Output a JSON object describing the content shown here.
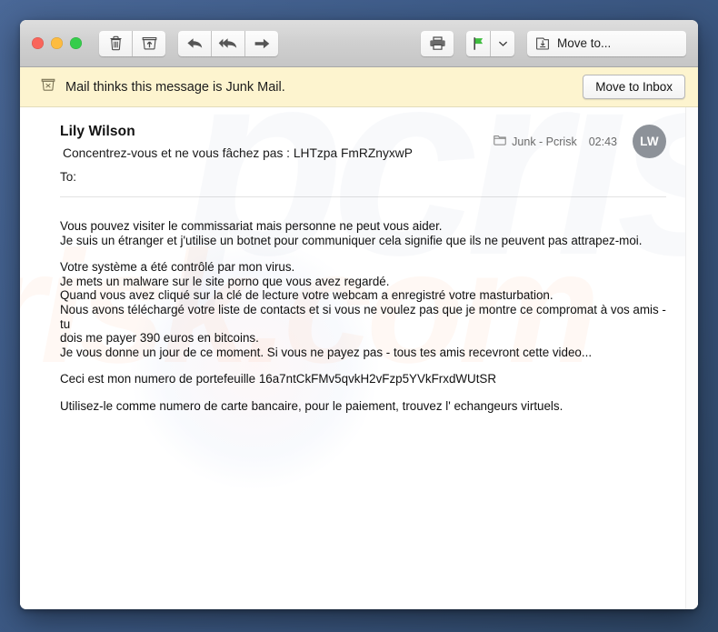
{
  "window": {
    "traffic_lights": [
      "close",
      "minimize",
      "zoom"
    ],
    "colors": {
      "desktop": "#3e5c89",
      "titlebar": "#cfcfcf",
      "banner": "#fdf4cf",
      "avatar": "#8d9299",
      "flag": "#3fbd3f"
    }
  },
  "toolbar": {
    "delete_label": "trash-icon",
    "not_junk_label": "not-junk-icon",
    "reply_label": "reply-icon",
    "reply_all_label": "reply-all-icon",
    "forward_label": "forward-icon",
    "print_label": "print-icon",
    "flag_label": "flag-icon",
    "flag_menu_label": "chevron-down-icon",
    "move_to_label": "Move to..."
  },
  "banner": {
    "icon": "junk-bin-icon",
    "text": "Mail thinks this message is Junk Mail.",
    "action_label": "Move to Inbox"
  },
  "message": {
    "sender": "Lily Wilson",
    "subject": "Concentrez-vous et ne vous fâchez pas  :  LHTzpa FmRZnyxwP",
    "to_label": "To:",
    "to_value": "",
    "mailbox_icon": "folder-icon",
    "mailbox": "Junk - Pcrisk",
    "time": "02:43",
    "avatar_initials": "LW",
    "body": {
      "p1_l1": "Vous pouvez visiter le commissariat mais personne ne peut vous aider.",
      "p1_l2": "Je suis un étranger et j'utilise un botnet pour communiquer cela signifie que ils ne peuvent pas attrapez-moi.",
      "p2_l1": "Votre système a été contrôlé par mon virus.",
      "p2_l2": "Je mets un malware sur le site porno que vous avez regardé.",
      "p2_l3": "Quand vous avez cliqué sur la clé de lecture votre webcam a enregistré votre masturbation.",
      "p2_l4": "Nous avons téléchargé votre liste de contacts et si vous ne voulez pas que je montre ce compromat à vos amis - tu",
      "p2_l5": "dois me payer 390 euros en bitcoins.",
      "p2_l6": "Je vous donne un jour de ce moment.  Si vous ne payez pas - tous tes amis recevront cette video...",
      "p3": "Ceci est mon numero de portefeuille  16a7ntCkFMv5qvkH2vFzp5YVkFrxdWUtSR",
      "p4": "Utilisez-le comme numero de carte bancaire, pour le paiement, trouvez l' echangeurs virtuels."
    }
  },
  "watermark": {
    "text": "risk.com",
    "text_top": "pcrisk"
  }
}
